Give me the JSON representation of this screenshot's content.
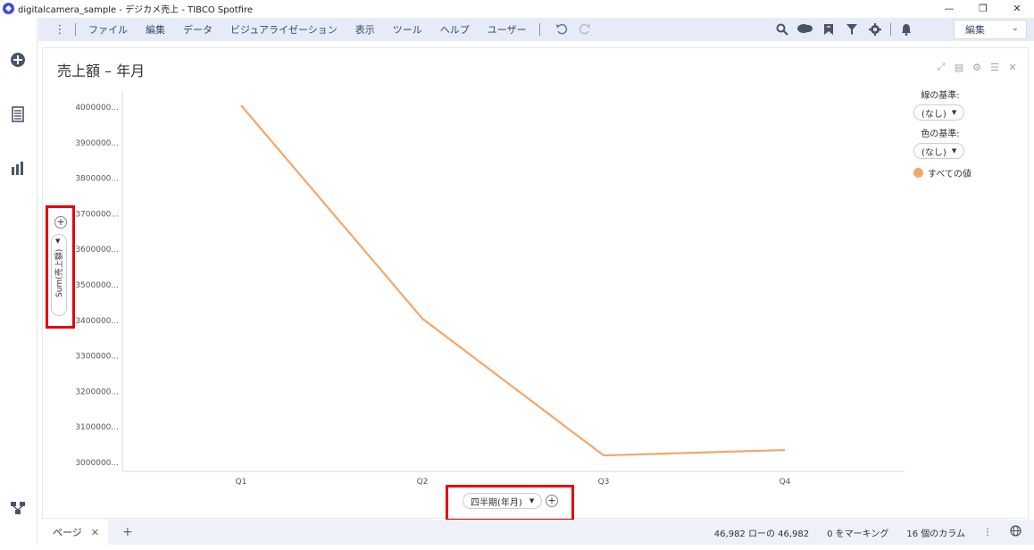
{
  "window": {
    "title": "digitalcamera_sample - デジカメ売上 - TIBCO Spotfire",
    "minimize": "—",
    "restore": "❐",
    "close": "✕"
  },
  "menu": {
    "items": [
      "ファイル",
      "編集",
      "データ",
      "ビジュアライゼーション",
      "表示",
      "ツール",
      "ヘルプ",
      "ユーザー"
    ],
    "edit_mode": "編集"
  },
  "visualization": {
    "title": "売上額 – 年月",
    "legend": {
      "line_label": "線の基準:",
      "line_value": "(なし)",
      "color_label": "色の基準:",
      "color_value": "(なし)",
      "entry": "すべての値"
    },
    "y_axis_selector": "Sum(売上額)",
    "x_axis_selector": "四半期(年月)"
  },
  "chart_data": {
    "type": "line",
    "categories": [
      "Q1",
      "Q2",
      "Q3",
      "Q4"
    ],
    "series": [
      {
        "values": [
          4005000,
          3405000,
          3020000,
          3035000
        ]
      }
    ],
    "yticks": [
      "4000000...",
      "3900000...",
      "3800000...",
      "3700000...",
      "3600000...",
      "3500000...",
      "3400000...",
      "3300000...",
      "3200000...",
      "3100000...",
      "3000000..."
    ],
    "ylim": [
      3000000,
      4000000
    ],
    "line_color": "#f5a66a",
    "grid": false,
    "legend_position": "right"
  },
  "status": {
    "page_tab": "ページ",
    "rows": "46,982 ローの 46,982",
    "marking": "0 をマーキング",
    "columns": "16 個のカラム"
  }
}
